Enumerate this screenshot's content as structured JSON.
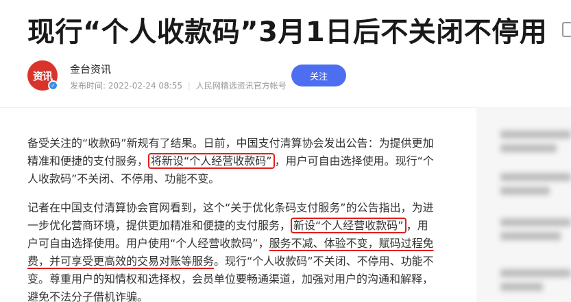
{
  "title": "现行“个人收款码”3月1日后不关闭不停用",
  "author": {
    "avatar_text": "资讯",
    "name": "金台资讯",
    "publish_label": "发布时间:",
    "publish_time": "2022-02-24 08:55",
    "account_desc": "人民网精选资讯官方帐号"
  },
  "follow_label": "关注",
  "article": {
    "p1": {
      "t1": "备受关注的“收款码”新规有了结果。日前，中国支付清算协会发出公告：为提供更加精准和便捷的支付服务，",
      "box": "将新设“个人经营收款码”",
      "t2": "，用户可自由选择使用。现行“个人收款码”不关闭、不停用、功能不变。"
    },
    "p2": {
      "t1": "记者在中国支付清算协会官网看到，这个“关于优化条码支付服务”的公告指出，为进一步优化营商环境，提供更加精准和便捷的支付服务，",
      "box": "新设“个人经营收款码”",
      "t2": "，用户可自由选择使用。用户使用“个人经营收款码”，",
      "underlined": "服务不减、体验不变，赋码过程免费，并可享受更高效的交易对账等服务",
      "t3": "。现行“个人收款码”不关闭、不停用、功能不变。尊重用户的知情权和选择权，会员单位要畅通渠道，加强对用户的沟通和解释，避免不法分子借机诈骗。"
    }
  },
  "colors": {
    "highlight": "#e01e1e",
    "follow_button": "#4e6ef2",
    "avatar": "#d9342b"
  }
}
